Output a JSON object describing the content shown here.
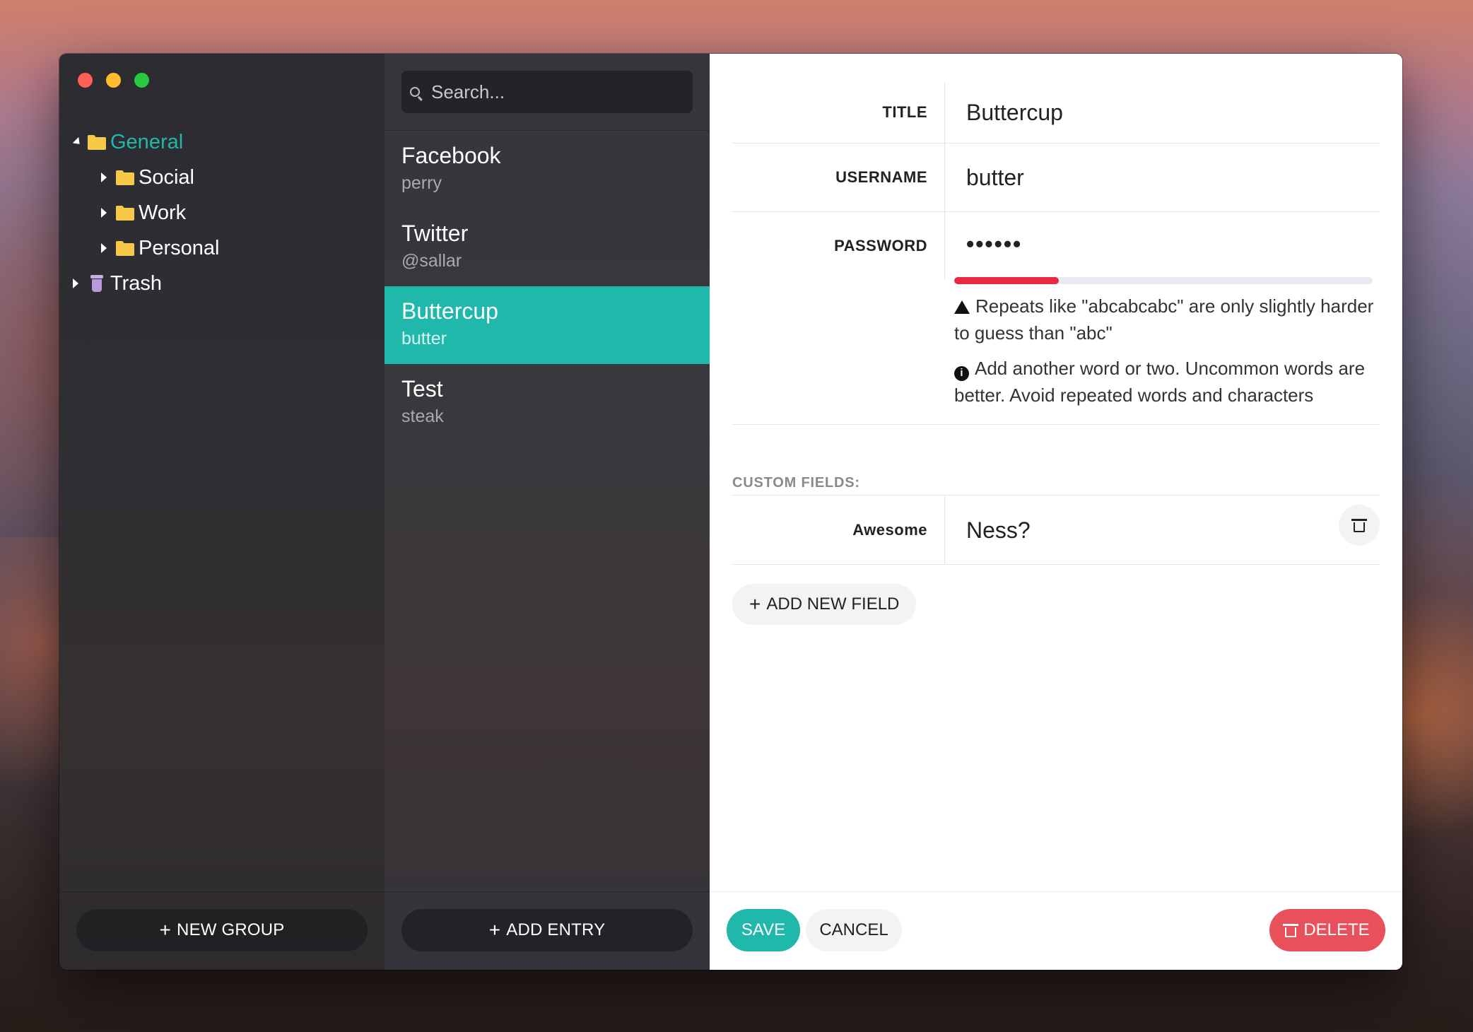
{
  "window": {
    "sidebar": {
      "groups": [
        {
          "label": "General",
          "expanded": true,
          "active": true,
          "icon": "folder-icon"
        },
        {
          "label": "Social",
          "icon": "folder-icon"
        },
        {
          "label": "Work",
          "icon": "folder-icon"
        },
        {
          "label": "Personal",
          "icon": "folder-icon"
        },
        {
          "label": "Trash",
          "icon": "trash-icon"
        }
      ],
      "new_group_label": "NEW GROUP"
    },
    "entries": {
      "search_placeholder": "Search...",
      "items": [
        {
          "title": "Facebook",
          "subtitle": "perry"
        },
        {
          "title": "Twitter",
          "subtitle": "@sallar"
        },
        {
          "title": "Buttercup",
          "subtitle": "butter",
          "selected": true
        },
        {
          "title": "Test",
          "subtitle": "steak"
        }
      ],
      "add_entry_label": "ADD ENTRY"
    },
    "detail": {
      "title_label": "TITLE",
      "title_value": "Buttercup",
      "username_label": "USERNAME",
      "username_value": "butter",
      "password_label": "PASSWORD",
      "password_value": "••••••",
      "strength_fraction": 0.25,
      "hint_warning": "Repeats like \"abcabcabc\" are only slightly harder to guess than \"abc\"",
      "hint_suggestion": "Add another word or two. Uncommon words are better. Avoid repeated words and characters",
      "custom_fields_heading": "CUSTOM FIELDS:",
      "custom_fields": [
        {
          "label": "Awesome",
          "value": "Ness?"
        }
      ],
      "add_field_label": "ADD NEW FIELD",
      "save_label": "SAVE",
      "cancel_label": "CANCEL",
      "delete_label": "DELETE"
    }
  },
  "colors": {
    "accent": "#1fb8aa",
    "danger": "#e8505b",
    "strength_bar": "#e8293f",
    "folder": "#f7c948"
  }
}
